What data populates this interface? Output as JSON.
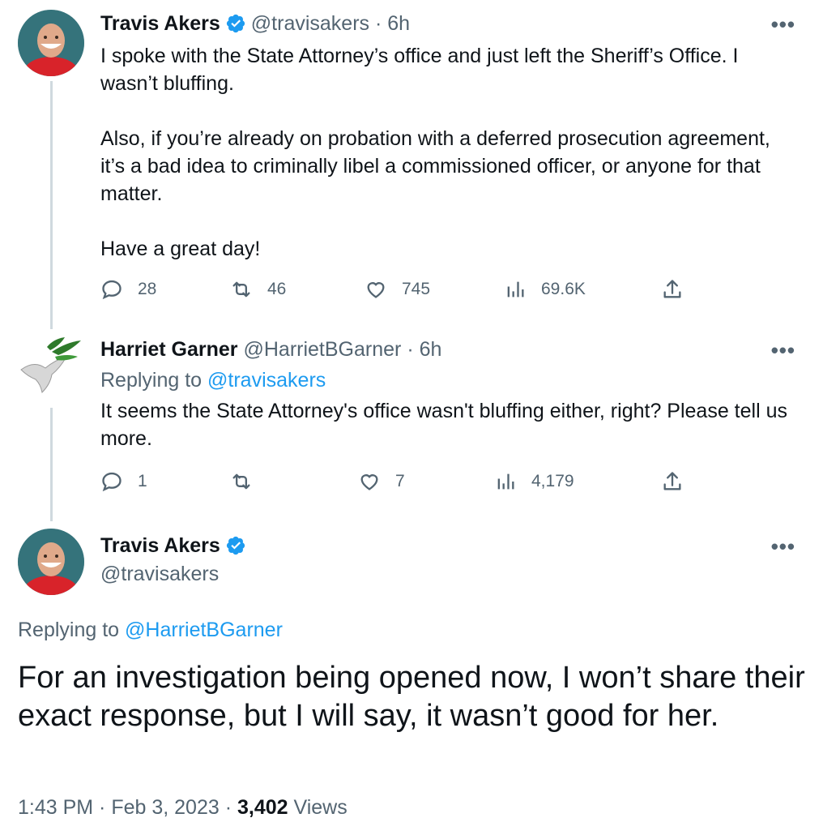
{
  "tweets": [
    {
      "name": "Travis Akers",
      "handle": "@travisakers",
      "time": "6h",
      "text": "I spoke with the State Attorney’s office and just left the Sheriff’s Office. I wasn’t bluffing.\n\nAlso, if you’re already on probation with a deferred prosecution agreement, it’s a bad idea to criminally libel a commissioned officer, or anyone for that matter.\n\nHave a great day!",
      "stats": {
        "replies": "28",
        "retweets": "46",
        "likes": "745",
        "views": "69.6K"
      }
    },
    {
      "name": "Harriet Garner",
      "handle": "@HarrietBGarner",
      "time": "6h",
      "replying_label": "Replying to",
      "replying_handle": "@travisakers",
      "text": "It seems the State Attorney's office wasn't bluffing either, right? Please tell us more.",
      "stats": {
        "replies": "1",
        "retweets": "",
        "likes": "7",
        "views": "4,179"
      }
    }
  ],
  "main_tweet": {
    "name": "Travis Akers",
    "handle": "@travisakers",
    "replying_label": "Replying to",
    "replying_handle": "@HarrietBGarner",
    "text": "For an investigation being opened now, I won’t share their exact response, but I will say, it wasn’t good for her.",
    "timestamp": "1:43 PM · Feb 3, 2023 · ",
    "views_count": "3,402",
    "views_label": " Views"
  },
  "separator": "·",
  "more_icon": "more-dots-icon",
  "colors": {
    "accent": "#1d9bf0",
    "muted": "#536471",
    "line": "#cfd9de"
  }
}
